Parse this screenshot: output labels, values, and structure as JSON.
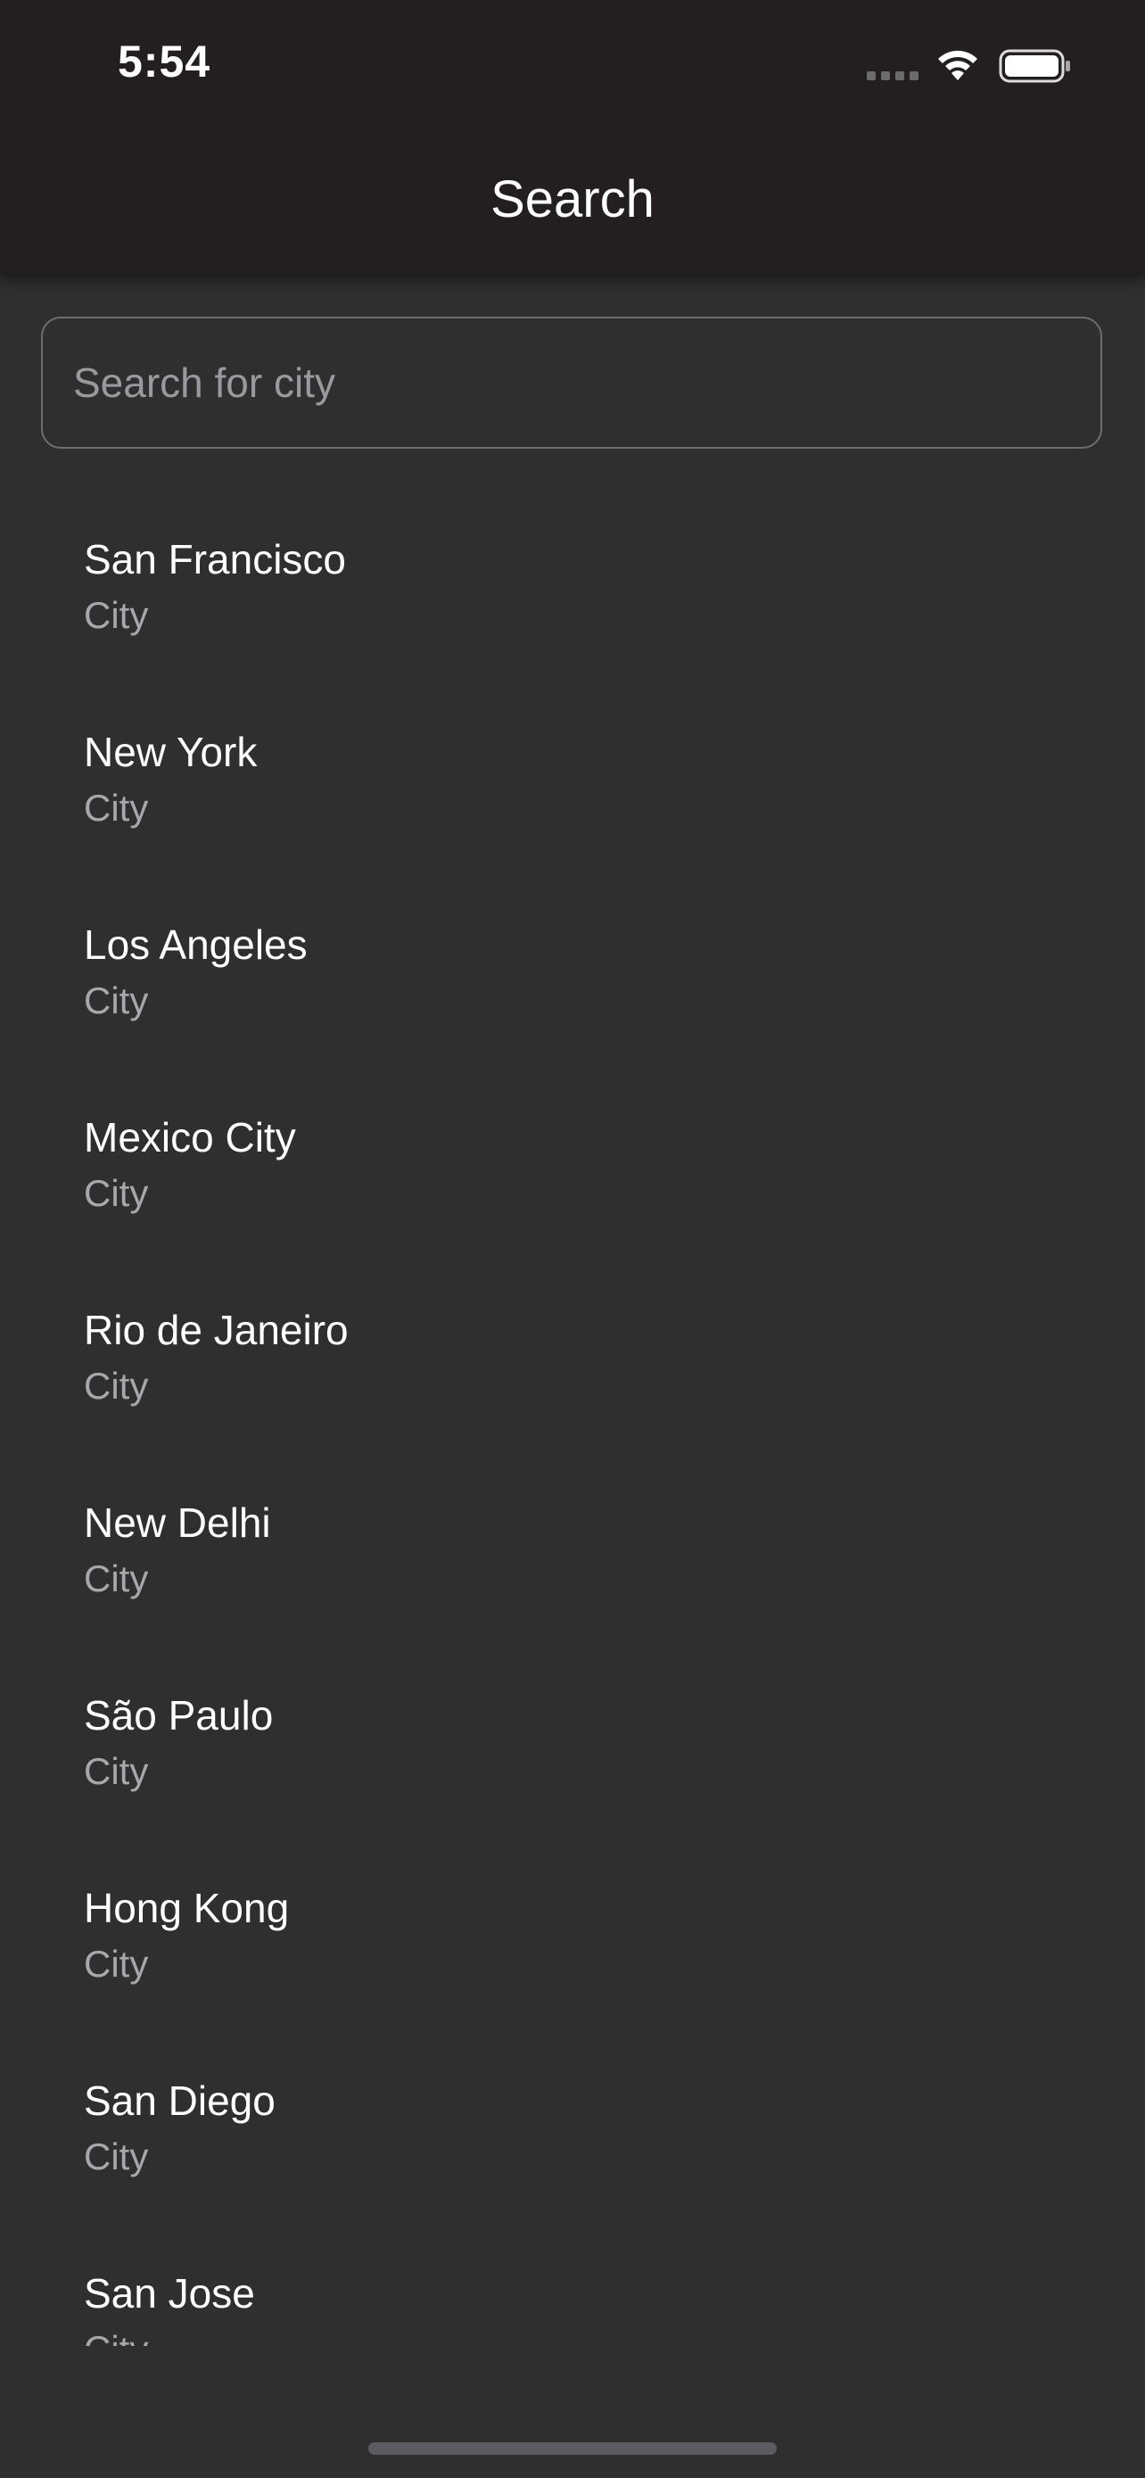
{
  "status_bar": {
    "time": "5:54"
  },
  "nav": {
    "title": "Search"
  },
  "search": {
    "placeholder": "Search for city",
    "value": ""
  },
  "results": [
    {
      "name": "San Francisco",
      "type": "City"
    },
    {
      "name": "New York",
      "type": "City"
    },
    {
      "name": "Los Angeles",
      "type": "City"
    },
    {
      "name": "Mexico City",
      "type": "City"
    },
    {
      "name": "Rio de Janeiro",
      "type": "City"
    },
    {
      "name": "New Delhi",
      "type": "City"
    },
    {
      "name": "São Paulo",
      "type": "City"
    },
    {
      "name": "Hong Kong",
      "type": "City"
    },
    {
      "name": "San Diego",
      "type": "City"
    },
    {
      "name": "San Jose",
      "type": "City"
    }
  ],
  "icons": {
    "signal": "cellular-signal-icon",
    "wifi": "wifi-icon",
    "battery": "battery-icon"
  },
  "colors": {
    "nav_background": "#231f20",
    "content_background": "#2f2f30",
    "primary_text": "#ffffff",
    "secondary_text": "#a8a8ac",
    "search_border": "#6e6e72"
  }
}
